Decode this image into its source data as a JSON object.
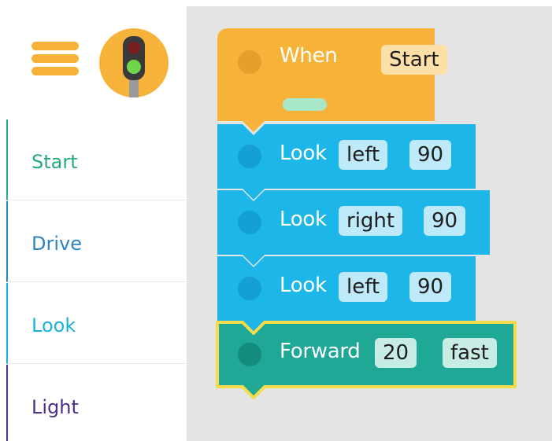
{
  "colors": {
    "orange": "#f7b23a",
    "blue": "#1db6e8",
    "teal": "#1fa896",
    "selected_outline": "#f4dc4c",
    "sidebar_start": "#2aa97a",
    "sidebar_drive": "#2b84c4",
    "sidebar_look": "#1cb0e0",
    "sidebar_light": "#4a2e8a",
    "workspace_bg": "#e4e4e4"
  },
  "header": {
    "menu_icon": "hamburger-icon",
    "device_icon": "traffic-light-icon"
  },
  "sidebar": {
    "items": [
      {
        "label": "Start",
        "color": "#2aa97a"
      },
      {
        "label": "Drive",
        "color": "#2b84c4"
      },
      {
        "label": "Look",
        "color": "#1cb0e0"
      },
      {
        "label": "Light",
        "color": "#4a2e8a"
      }
    ]
  },
  "program": {
    "when_block": {
      "label": "When",
      "trigger": "Start"
    },
    "blocks": [
      {
        "label": "Look",
        "direction": "left",
        "degrees": "90"
      },
      {
        "label": "Look",
        "direction": "right",
        "degrees": "90"
      },
      {
        "label": "Look",
        "direction": "left",
        "degrees": "90"
      },
      {
        "label": "Forward",
        "distance": "20",
        "speed": "fast"
      }
    ]
  }
}
